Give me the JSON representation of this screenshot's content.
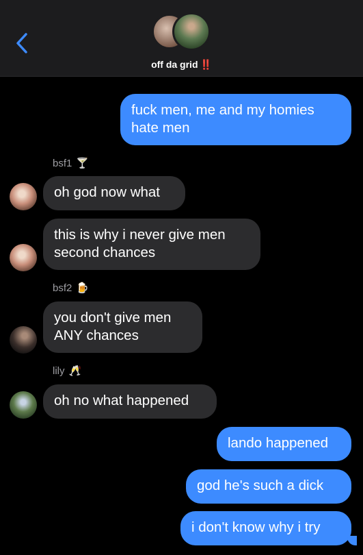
{
  "header": {
    "back_icon": "chevron-left-icon",
    "title": "off da grid",
    "title_emoji": "‼️"
  },
  "messages": [
    {
      "direction": "outgoing",
      "lines": [
        "fuck men, me and my homies",
        "hate men"
      ]
    },
    {
      "direction": "incoming",
      "sender": "bsf1",
      "sender_emoji": "🍸",
      "lines": [
        "oh god now what"
      ]
    },
    {
      "direction": "incoming",
      "sender": "bsf1",
      "lines": [
        "this is why i never give men",
        "second chances"
      ]
    },
    {
      "direction": "incoming",
      "sender": "bsf2",
      "sender_emoji": "🍺",
      "lines": [
        "you don't give men",
        "ANY chances"
      ]
    },
    {
      "direction": "incoming",
      "sender": "lily",
      "sender_emoji": "🥂",
      "lines": [
        "oh no what happened"
      ]
    },
    {
      "direction": "outgoing",
      "lines": [
        "lando happened"
      ]
    },
    {
      "direction": "outgoing",
      "lines": [
        "god he's such a dick"
      ]
    },
    {
      "direction": "outgoing",
      "lines": [
        "i don't know why i try"
      ]
    }
  ],
  "colors": {
    "outgoing_bubble": "#3d8bff",
    "incoming_bubble": "#2c2c2e",
    "header_bg": "#1c1c1e",
    "accent": "#3d8bff"
  }
}
